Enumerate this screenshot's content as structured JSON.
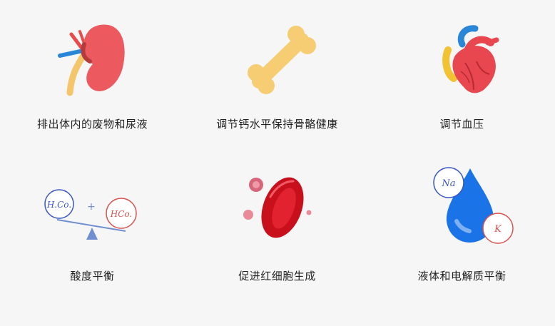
{
  "items": [
    {
      "label": "排出体内的废物和尿液",
      "icon": "kidney-icon"
    },
    {
      "label": "调节钙水平保持骨骼健康",
      "icon": "bone-icon"
    },
    {
      "label": "调节血压",
      "icon": "heart-icon"
    },
    {
      "label": "酸度平衡",
      "icon": "acid-balance-icon",
      "badges": [
        "H.Co.",
        "HCo."
      ],
      "plus": "+"
    },
    {
      "label": "促进红细胞生成",
      "icon": "red-blood-cell-icon"
    },
    {
      "label": "液体和电解质平衡",
      "icon": "electrolyte-drop-icon",
      "badges": [
        "Na",
        "K"
      ]
    }
  ],
  "colors": {
    "kidney": "#ec5a5f",
    "bone": "#f6cd72",
    "heart": "#e9474f",
    "blue_ink": "#3a55c4",
    "red_ink": "#d9534f",
    "cell": "#c8101c",
    "drop": "#1b73e8"
  }
}
